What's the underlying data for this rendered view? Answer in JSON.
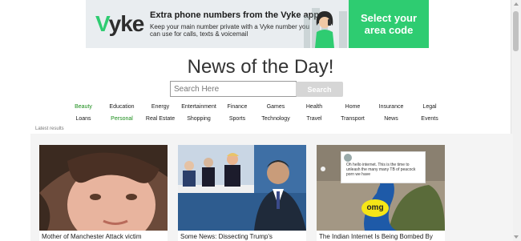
{
  "ad": {
    "logo": "yke",
    "logo_v": "V",
    "headline": "Extra phone numbers from the Vyke app",
    "subtext": "Keep your main number private with a Vyke number you can use for calls, texts & voicemail",
    "cta": "Select your area code",
    "accent": "#2ecc71"
  },
  "page": {
    "title": "News of the Day!",
    "search_placeholder": "Search Here",
    "search_button": "Search"
  },
  "categories": [
    {
      "label": "Beauty",
      "green": true
    },
    {
      "label": "Education",
      "green": false
    },
    {
      "label": "Energy",
      "green": false
    },
    {
      "label": "Entertainment",
      "green": false
    },
    {
      "label": "Finance",
      "green": false
    },
    {
      "label": "Games",
      "green": false
    },
    {
      "label": "Health",
      "green": false
    },
    {
      "label": "Home",
      "green": false
    },
    {
      "label": "Insurance",
      "green": false
    },
    {
      "label": "Legal",
      "green": false
    },
    {
      "label": "Loans",
      "green": false
    },
    {
      "label": "Personal",
      "green": true
    },
    {
      "label": "Real Estate",
      "green": false
    },
    {
      "label": "Shopping",
      "green": false
    },
    {
      "label": "Sports",
      "green": false
    },
    {
      "label": "Technology",
      "green": false
    },
    {
      "label": "Travel",
      "green": false
    },
    {
      "label": "Transport",
      "green": false
    },
    {
      "label": "News",
      "green": false
    },
    {
      "label": "Events",
      "green": false
    }
  ],
  "latest_label": "Latest results",
  "results": [
    {
      "caption": "Mother of Manchester Attack victim"
    },
    {
      "caption": "Some News: Dissecting Trump's"
    },
    {
      "caption": "The Indian Internet Is Being Bombed By",
      "tweet_text": "Oh hello internet. This is the time to unleash the many many TB of peacock porn we have",
      "badge": "omg"
    }
  ]
}
